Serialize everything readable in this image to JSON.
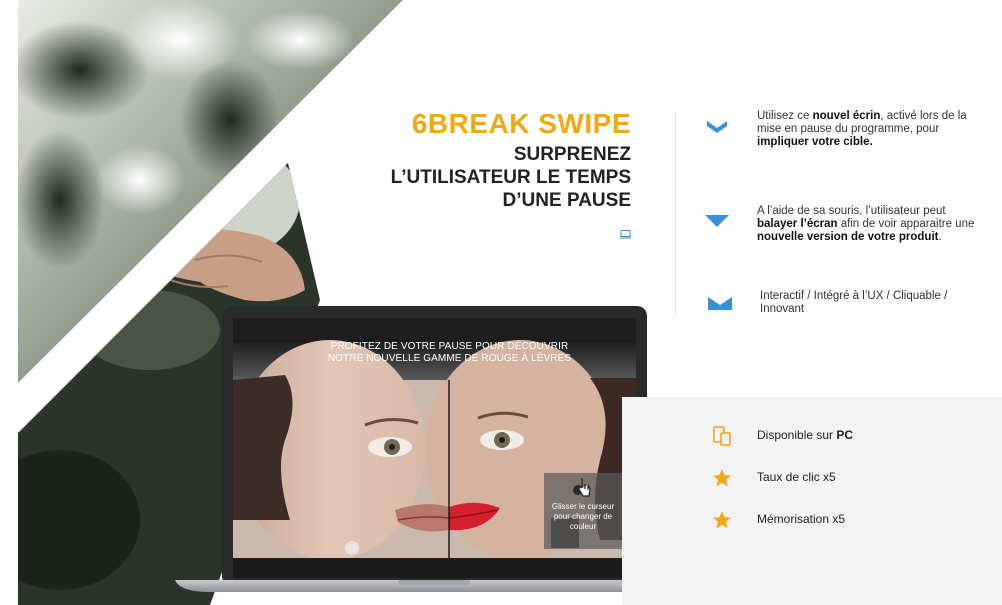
{
  "brand_title": "6BREAK SWIPE",
  "headline_lines": [
    "SURPRENEZ",
    "L’UTILISATEUR LE TEMPS",
    "D’UNE PAUSE"
  ],
  "monitor_icon": "laptop-icon",
  "features": [
    {
      "icon": "chevron-down-icon",
      "lines": [
        [
          {
            "t": "Utilisez ce "
          },
          {
            "t": "nouvel écrin",
            "b": true
          },
          {
            "t": ", activé lors de la"
          }
        ],
        [
          {
            "t": "mise en pause du programme, pour"
          }
        ],
        [
          {
            "t": "impliquer votre cible.",
            "b": true
          }
        ]
      ]
    },
    {
      "icon": "triangle-down-icon",
      "lines": [
        [
          {
            "t": "A l’aide de sa souris, l’utilisateur peut"
          }
        ],
        [
          {
            "t": "balayer l’écran",
            "b": true
          },
          {
            "t": " afin de voir apparaitre une"
          }
        ],
        [
          {
            "t": "nouvelle version de votre produit",
            "b": true
          },
          {
            "t": "."
          }
        ]
      ]
    },
    {
      "icon": "m-shape-icon",
      "lines": [
        [
          {
            "t": "Interactif / Intégré à l’UX / Cliquable /"
          }
        ],
        [
          {
            "t": "Innovant"
          }
        ]
      ]
    }
  ],
  "stats": [
    {
      "icon": "devices-icon",
      "prefix": "Disponible sur ",
      "bold": "PC"
    },
    {
      "icon": "star-icon",
      "prefix": "Taux de clic x5",
      "bold": ""
    },
    {
      "icon": "star-icon",
      "prefix": "Mémorisation x5",
      "bold": ""
    }
  ],
  "screen": {
    "line1": "PROFITEZ DE VOTRE PAUSE POUR DÉCOUVRIR",
    "line2": "NOTRE NOUVELLE GAMME DE ROUGE À LÈVRES",
    "cursor_hint": [
      "Glisser le curseur",
      "pour changer de",
      "couleur"
    ]
  },
  "colors": {
    "accent_orange": "#f3a712",
    "accent_blue": "#3a8fd9",
    "lip_red": "#d41f2e"
  }
}
